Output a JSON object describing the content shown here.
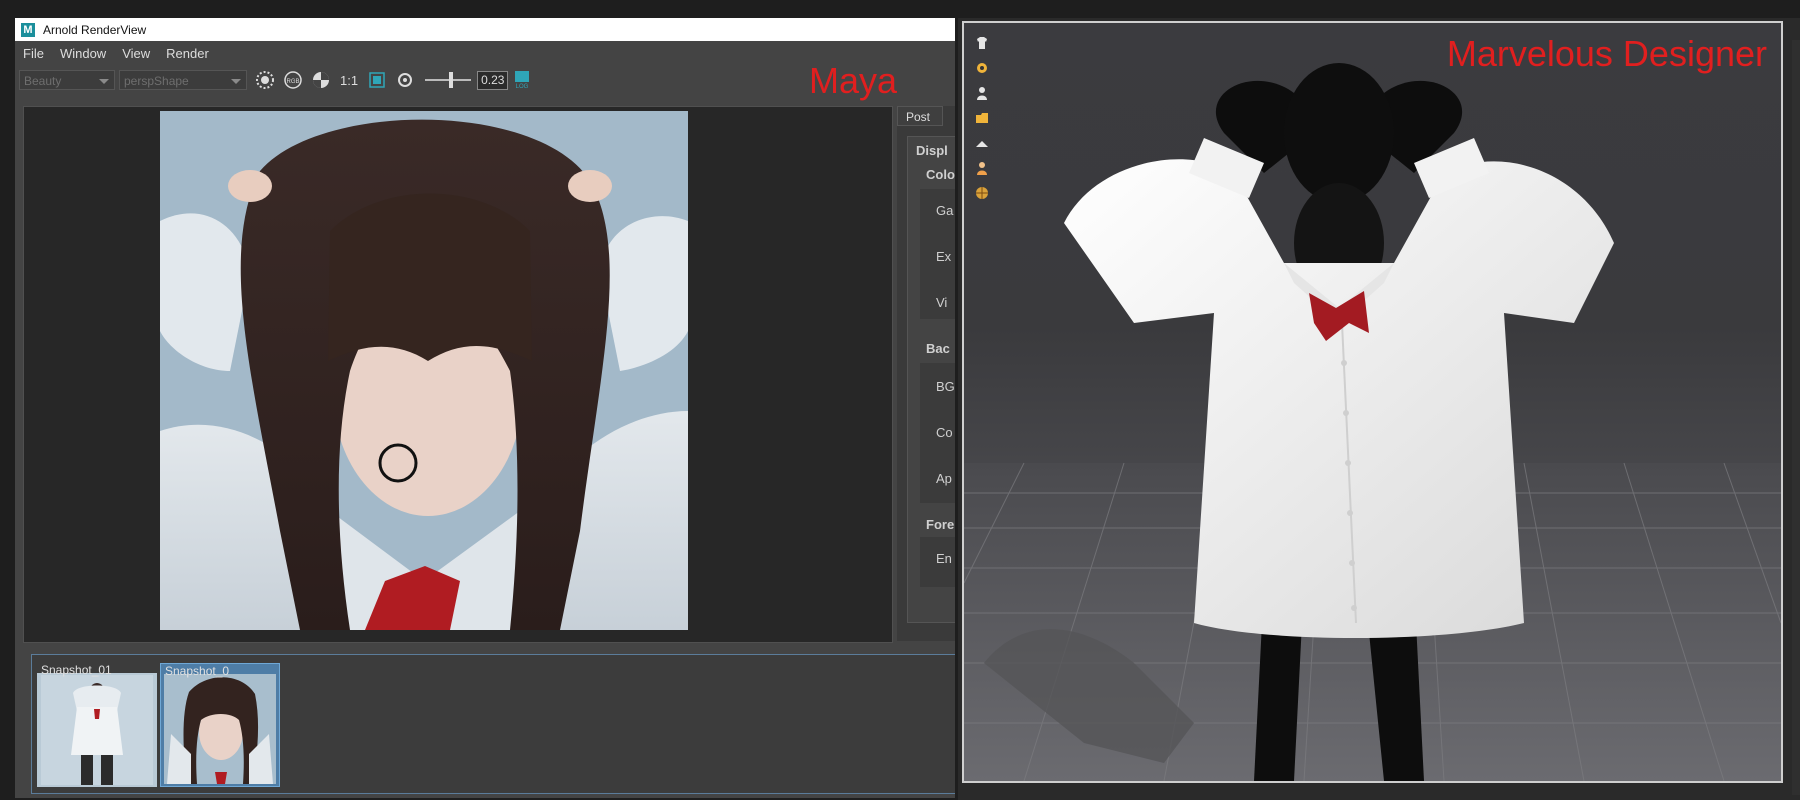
{
  "maya": {
    "window_title": "Arnold RenderView",
    "menu": [
      "File",
      "Window",
      "View",
      "Render"
    ],
    "toolbar": {
      "aov_value": "Beauty",
      "camera_value": "perspShape",
      "ratio_label": "1:1",
      "exposure_value": "0.23",
      "rgb_icon_text": "RGB",
      "log_icon_text": "LOG"
    },
    "overlay_label": "Maya",
    "post_panel": {
      "tab_label": "Post",
      "labels": [
        "Displ",
        "Colo",
        "Ga",
        "Ex",
        "Vi",
        "Bac",
        "BG",
        "Co",
        "Ap",
        "Fore",
        "En"
      ]
    },
    "snapshots": [
      {
        "label": "Snapshot_01"
      },
      {
        "label": "Snapshot_0"
      }
    ]
  },
  "md": {
    "overlay_label": "Marvelous Designer",
    "tools": [
      "shirt-icon",
      "gear-icon",
      "avatar-icon",
      "folder-icon",
      "hanger-icon",
      "person-icon",
      "globe-icon"
    ]
  }
}
